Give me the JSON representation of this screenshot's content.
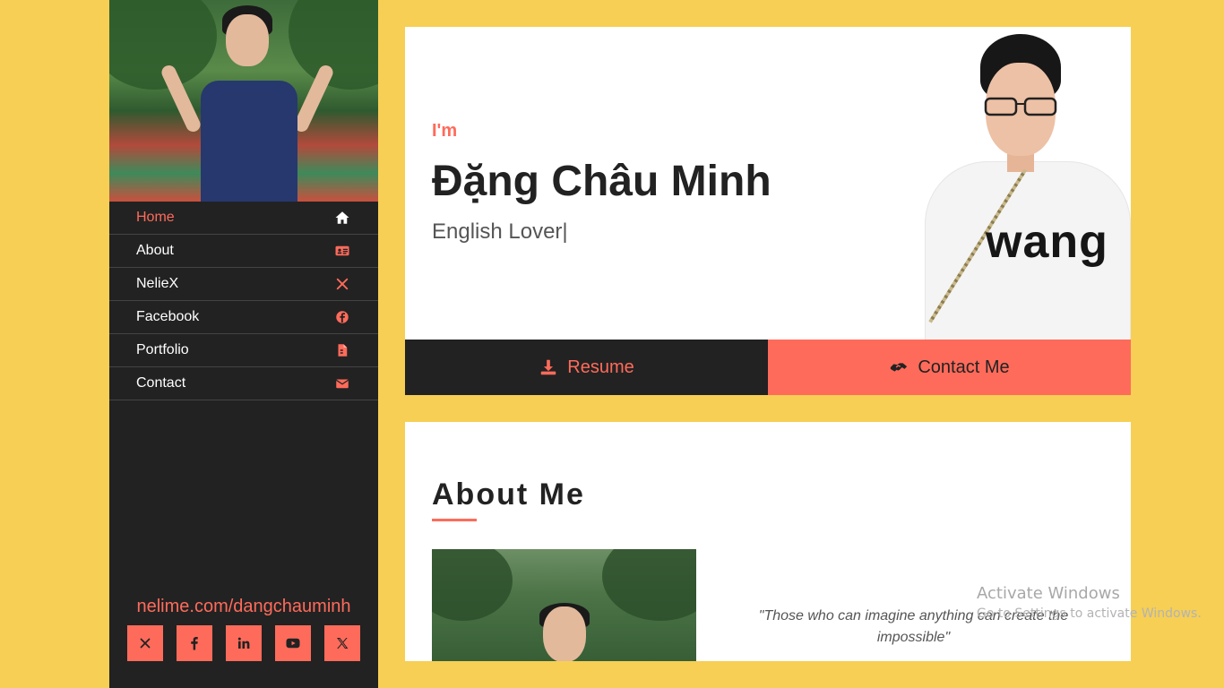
{
  "sidebar": {
    "nav": [
      {
        "label": "Home",
        "icon": "home-icon",
        "active": true
      },
      {
        "label": "About",
        "icon": "id-card-icon",
        "active": false
      },
      {
        "label": "NelieX",
        "icon": "x-mark-icon",
        "active": false
      },
      {
        "label": "Facebook",
        "icon": "facebook-icon",
        "active": false
      },
      {
        "label": "Portfolio",
        "icon": "file-icon",
        "active": false
      },
      {
        "label": "Contact",
        "icon": "envelope-icon",
        "active": false
      }
    ],
    "site_url": "nelime.com/dangchauminh",
    "socials": [
      "close-x-icon",
      "facebook-f-icon",
      "linkedin-icon",
      "youtube-icon",
      "x-twitter-icon"
    ]
  },
  "hero": {
    "intro": "I'm",
    "name": "Đặng Châu Minh",
    "role": "English Lover|",
    "photo_shirt_text": "wang",
    "resume_label": "Resume",
    "contact_label": "Contact Me"
  },
  "about": {
    "title": "About Me",
    "quote": "\"Those who can imagine anything can create the impossible\""
  },
  "watermark": {
    "title": "Activate Windows",
    "subtitle": "Go to Settings to activate Windows."
  },
  "colors": {
    "background": "#f6cf54",
    "sidebar": "#222222",
    "accent": "#ff6b5b",
    "card": "#ffffff"
  }
}
